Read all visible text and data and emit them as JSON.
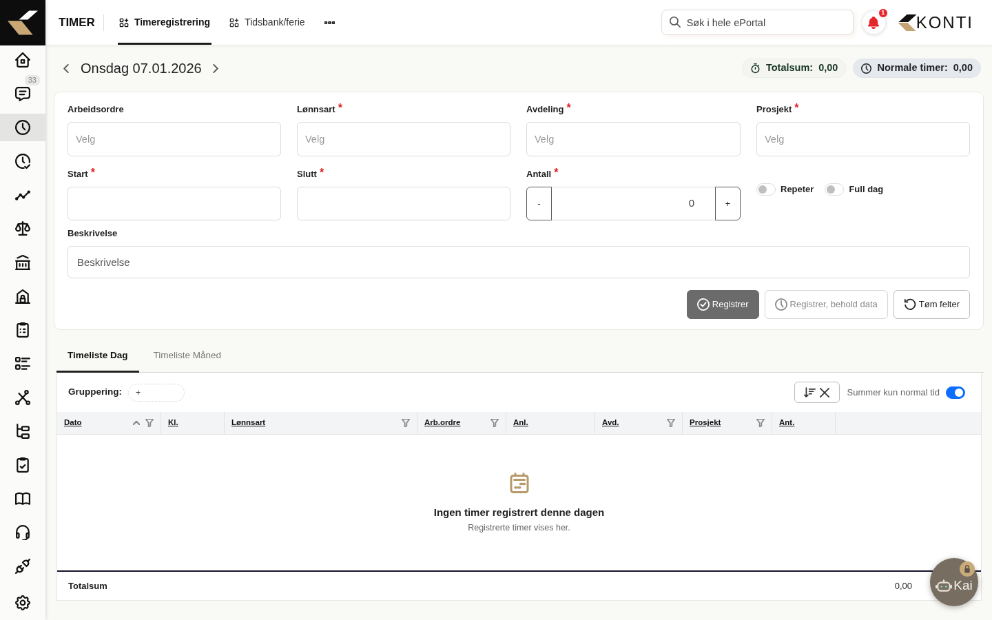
{
  "sidebar": {
    "items": [
      {
        "selected": false
      },
      {
        "selected": false,
        "badge": "33"
      },
      {
        "selected": true
      },
      {
        "selected": false
      },
      {
        "selected": false
      },
      {
        "selected": false
      },
      {
        "selected": false
      },
      {
        "selected": false
      },
      {
        "selected": false
      },
      {
        "selected": false
      },
      {
        "selected": false
      },
      {
        "selected": false
      },
      {
        "selected": false
      },
      {
        "selected": false
      },
      {
        "selected": false
      },
      {
        "selected": false
      },
      {
        "selected": false
      }
    ]
  },
  "topbar": {
    "section": "TIMER",
    "tabs": [
      {
        "label": "Timeregistrering",
        "selected": true
      },
      {
        "label": "Tidsbank/ferie",
        "selected": false
      }
    ],
    "search": {
      "placeholder": "Søk i hele ePortal"
    },
    "notifications": {
      "count": "1"
    },
    "brand": "KONTI"
  },
  "date_bar": {
    "title": "Onsdag 07.01.2026",
    "stats": [
      {
        "kind": "total",
        "label": "Totalsum:",
        "value": "0,00"
      },
      {
        "kind": "normal",
        "label": "Normale timer:",
        "value": "0,00"
      }
    ]
  },
  "form": {
    "required_mark": "*",
    "fields": [
      {
        "kind": "select",
        "label": "Arbeidsordre",
        "required": false,
        "placeholder": "Velg"
      },
      {
        "kind": "select",
        "label": "Lønnsart",
        "required": true,
        "placeholder": "Velg"
      },
      {
        "kind": "select",
        "label": "Avdeling",
        "required": true,
        "placeholder": "Velg"
      },
      {
        "kind": "select",
        "label": "Prosjekt",
        "required": true,
        "placeholder": "Velg"
      },
      {
        "kind": "time",
        "label": "Start",
        "required": true
      },
      {
        "kind": "time",
        "label": "Slutt",
        "required": true
      },
      {
        "kind": "stepper",
        "label": "Antall",
        "required": true,
        "value": "0",
        "decrement": "-",
        "increment": "+"
      },
      {
        "kind": "toggles",
        "items": [
          {
            "label": "Repeter",
            "on": false
          },
          {
            "label": "Full dag",
            "on": false
          }
        ]
      },
      {
        "kind": "text",
        "label": "Beskrivelse",
        "required": false,
        "placeholder": "Beskrivelse"
      }
    ],
    "actions": [
      {
        "kind": "primary",
        "label": "Registrer"
      },
      {
        "kind": "keep",
        "label": "Registrer, behold data"
      },
      {
        "kind": "clear",
        "label": "Tøm felter"
      }
    ]
  },
  "timelist": {
    "tabs": [
      {
        "label": "Timeliste Dag",
        "selected": true
      },
      {
        "label": "Timeliste Måned",
        "selected": false
      }
    ],
    "grouping": {
      "label": "Gruppering:",
      "add": "+"
    },
    "normal_time_toggle": {
      "label": "Summer kun normal tid",
      "on": true
    },
    "columns": [
      {
        "label": "Dato",
        "sorted": true,
        "filter": true
      },
      {
        "label": "Kl.",
        "sorted": false,
        "filter": false
      },
      {
        "label": "Lønnsart",
        "sorted": false,
        "filter": true
      },
      {
        "label": "Arb.ordre",
        "sorted": false,
        "filter": true
      },
      {
        "label": "Anl.",
        "sorted": false,
        "filter": false
      },
      {
        "label": "Avd.",
        "sorted": false,
        "filter": true
      },
      {
        "label": "Prosjekt",
        "sorted": false,
        "filter": true
      },
      {
        "label": "Ant.",
        "sorted": false,
        "filter": false
      }
    ],
    "empty": {
      "title": "Ingen timer registrert denne dagen",
      "text": "Registrerte timer vises her."
    },
    "footer": {
      "label": "Totalsum",
      "value": "0,00"
    }
  },
  "assistant": {
    "label": "Kai"
  }
}
